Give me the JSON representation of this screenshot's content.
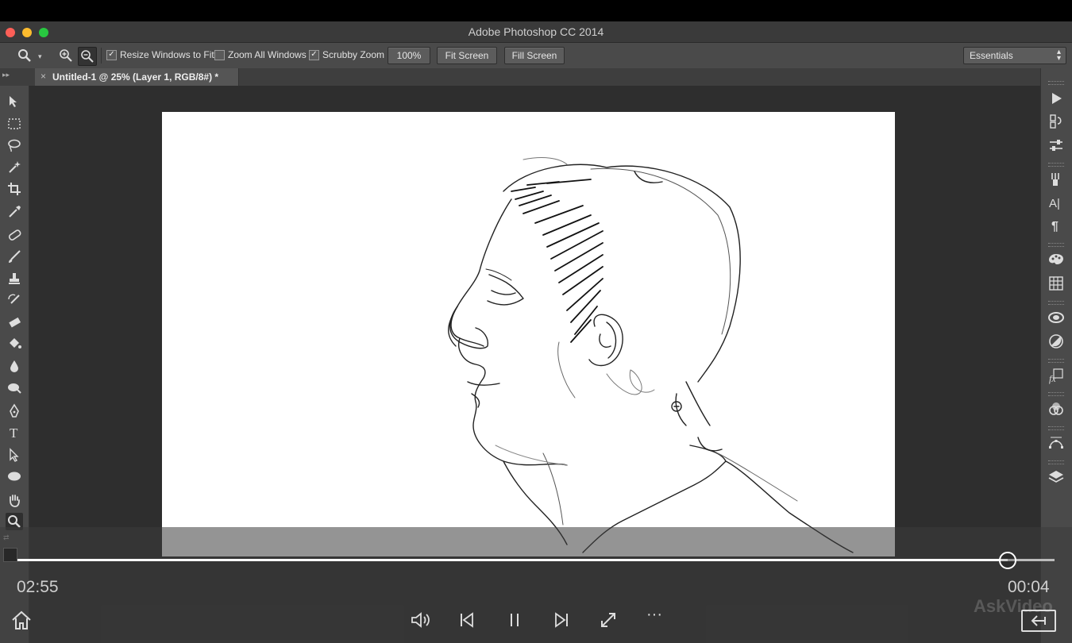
{
  "window": {
    "title": "Adobe Photoshop CC 2014",
    "traffic_colors": {
      "close": "#fc5f57",
      "minimize": "#fdbc2e",
      "zoom": "#28c840"
    }
  },
  "options_bar": {
    "resize_windows": {
      "label": "Resize Windows to Fit",
      "checked": true
    },
    "zoom_all": {
      "label": "Zoom All Windows",
      "checked": false
    },
    "scrubby_zoom": {
      "label": "Scrubby Zoom",
      "checked": true
    },
    "btn_100": "100%",
    "btn_fit": "Fit Screen",
    "btn_fill": "Fill Screen",
    "workspace": "Essentials"
  },
  "document": {
    "tab_label": "Untitled-1 @ 25% (Layer 1, RGB/8#) *",
    "close_glyph": "×"
  },
  "left_tools": [
    "move-tool-icon",
    "marquee-tool-icon",
    "lasso-tool-icon",
    "magic-wand-tool-icon",
    "crop-tool-icon",
    "eyedropper-tool-icon",
    "healing-brush-tool-icon",
    "brush-tool-icon",
    "clone-stamp-tool-icon",
    "history-brush-tool-icon",
    "eraser-tool-icon",
    "paint-bucket-tool-icon",
    "blur-tool-icon",
    "dodge-tool-icon",
    "pen-tool-icon",
    "type-tool-icon",
    "path-selection-tool-icon",
    "ellipse-tool-icon",
    "hand-tool-icon",
    "zoom-tool-icon"
  ],
  "type_tool_glyph": "T",
  "right_panel_icons": [
    "play-actions-icon",
    "history-icon",
    "adjustments-icon",
    "brush-presets-icon",
    "character-icon",
    "paragraph-icon",
    "color-icon",
    "swatches-icon",
    "libraries-icon",
    "adjust-circle-icon",
    "styles-fx-icon",
    "channels-icon",
    "paths-icon",
    "layers-icon"
  ],
  "right_glyphs": {
    "character": "A|",
    "paragraph": "¶",
    "fx": "fx"
  },
  "player": {
    "elapsed": "02:55",
    "remaining": "00:04",
    "progress": 0.955,
    "watermark": "AskVideo"
  }
}
